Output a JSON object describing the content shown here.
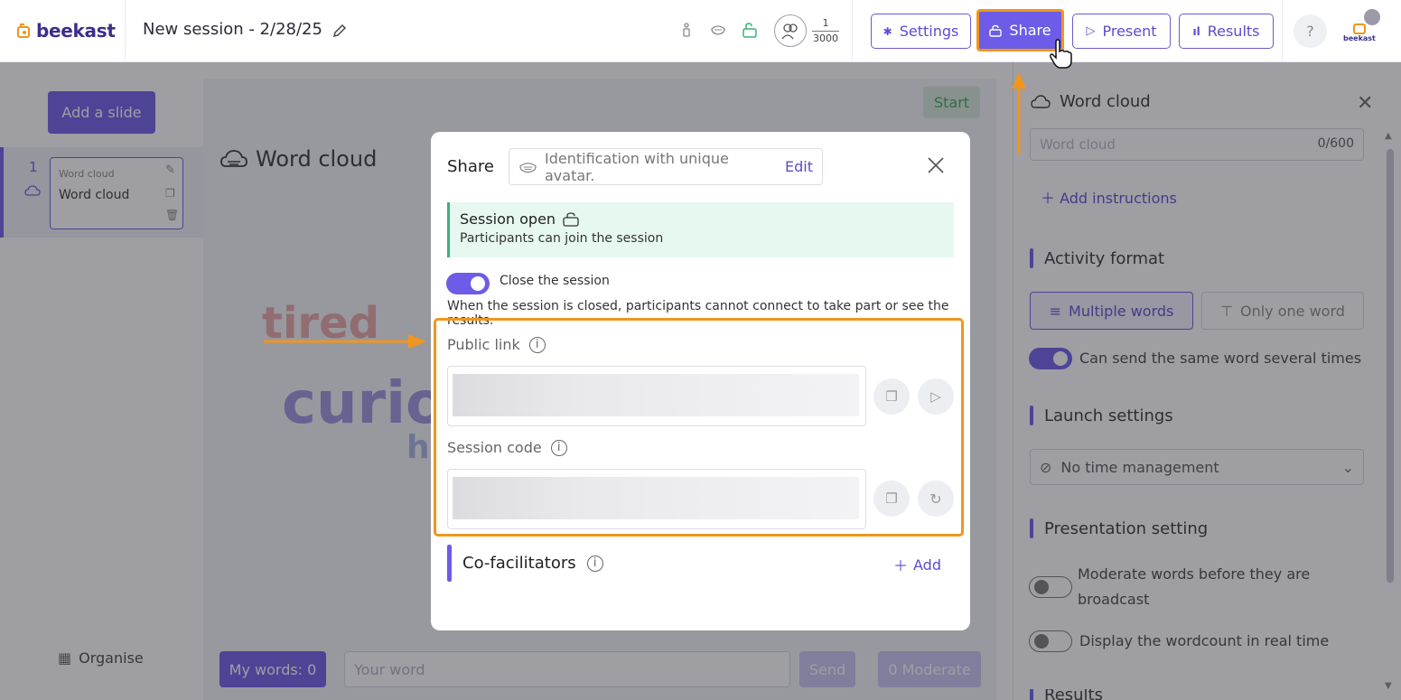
{
  "header": {
    "brand": "beekast",
    "session_title": "New session - 2/28/25",
    "participants_current": "1",
    "participants_max": "3000",
    "settings_label": "Settings",
    "share_label": "Share",
    "present_label": "Present",
    "results_label": "Results",
    "help_label": "?",
    "badge_brand": "beekast"
  },
  "left_panel": {
    "add_slide_label": "Add a slide",
    "slide_number": "1",
    "slide_type": "Word cloud",
    "slide_name": "Word cloud",
    "organise_label": "Organise"
  },
  "center": {
    "start_label": "Start",
    "activity_title": "Word cloud",
    "my_words_label": "My words: 0",
    "your_word_placeholder": "Your word",
    "send_label": "Send",
    "moderate_label": "0 Moderate"
  },
  "right_panel": {
    "title": "Word cloud",
    "input_placeholder": "Word cloud",
    "input_counter": "0/600",
    "add_instructions_label": "Add instructions",
    "activity_format_heading": "Activity format",
    "multiple_words_label": "Multiple words",
    "only_one_word_label": "Only one word",
    "same_word_label": "Can send the same word several times",
    "launch_settings_heading": "Launch settings",
    "time_management_value": "No time management",
    "presentation_setting_heading": "Presentation setting",
    "moderate_words_label": "Moderate words before they are broadcast",
    "display_wordcount_label": "Display the wordcount in real time",
    "results_heading": "Results"
  },
  "modal": {
    "title": "Share",
    "identification_text": "Identification with unique avatar.",
    "edit_label": "Edit",
    "status_title": "Session open",
    "status_subtitle": "Participants can join the session",
    "close_session_label": "Close the session",
    "close_session_note": "When the session is closed, participants cannot connect to take part or see the results.",
    "public_link_label": "Public link",
    "session_code_label": "Session code",
    "cofacilitators_label": "Co-facilitators",
    "add_label": "Add"
  },
  "colors": {
    "accent": "#6c5ce7",
    "highlight": "#f0961e",
    "status_green": "#3bb07a"
  }
}
